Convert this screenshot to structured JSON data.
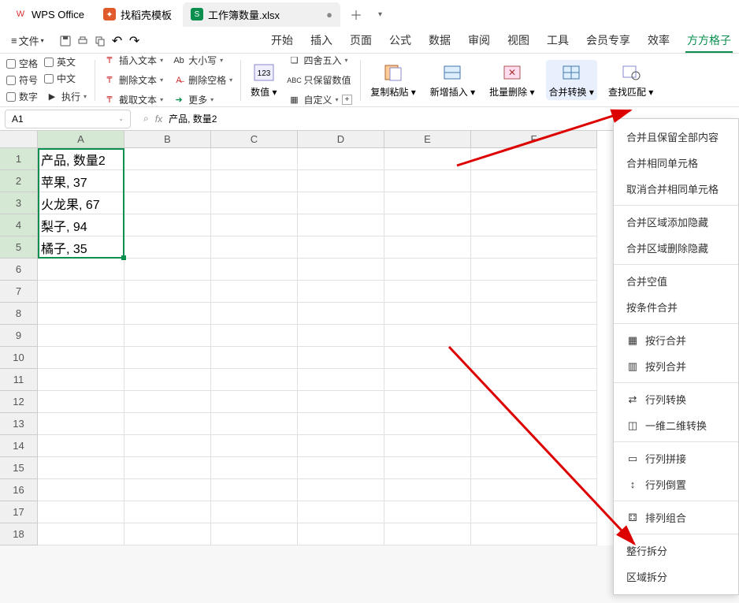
{
  "title_tabs": [
    {
      "icon": "wps",
      "label": "WPS Office"
    },
    {
      "icon": "doc",
      "label": "找稻壳模板"
    },
    {
      "icon": "xls",
      "label": "工作簿数量.xlsx",
      "active": true,
      "dirty": true
    }
  ],
  "menu": {
    "file": "文件",
    "tabs": [
      "开始",
      "插入",
      "页面",
      "公式",
      "数据",
      "审阅",
      "视图",
      "工具",
      "会员专享",
      "效率",
      "方方格子"
    ],
    "active": 10
  },
  "ribbon": {
    "checks_col1": [
      "空格",
      "符号",
      "数字"
    ],
    "checks_col2": [
      "英文",
      "中文",
      "执行"
    ],
    "text_ops": [
      "插入文本",
      "删除文本",
      "截取文本"
    ],
    "case_ops": [
      "大小写",
      "删除空格",
      "更多"
    ],
    "num_big": "数值",
    "num_ops": [
      "四舍五入",
      "只保留数值",
      "自定义"
    ],
    "big_buttons": [
      "复制粘贴",
      "新增插入",
      "批量删除",
      "合并转换",
      "查找匹配"
    ]
  },
  "formula": {
    "cell_ref": "A1",
    "value": "产品, 数量2"
  },
  "columns": [
    "A",
    "B",
    "C",
    "D",
    "E",
    "F"
  ],
  "rows": [
    {
      "n": 1,
      "a": "产品, 数量2"
    },
    {
      "n": 2,
      "a": "苹果, 37"
    },
    {
      "n": 3,
      "a": "火龙果, 67"
    },
    {
      "n": 4,
      "a": "梨子, 94"
    },
    {
      "n": 5,
      "a": "橘子, 35"
    },
    {
      "n": 6,
      "a": ""
    },
    {
      "n": 7,
      "a": ""
    },
    {
      "n": 8,
      "a": ""
    },
    {
      "n": 9,
      "a": ""
    },
    {
      "n": 10,
      "a": ""
    },
    {
      "n": 11,
      "a": ""
    },
    {
      "n": 12,
      "a": ""
    },
    {
      "n": 13,
      "a": ""
    },
    {
      "n": 14,
      "a": ""
    },
    {
      "n": 15,
      "a": ""
    },
    {
      "n": 16,
      "a": ""
    },
    {
      "n": 17,
      "a": ""
    },
    {
      "n": 18,
      "a": ""
    }
  ],
  "chart_data": {
    "type": "table",
    "description": "Selected cells A1:A5 containing CSV-like text",
    "cells": [
      "产品, 数量2",
      "苹果, 37",
      "火龙果, 67",
      "梨子, 94",
      "橘子, 35"
    ]
  },
  "dropdown": {
    "items_top": [
      "合并且保留全部内容",
      "合并相同单元格",
      "取消合并相同单元格"
    ],
    "items_mid": [
      "合并区域添加隐藏",
      "合并区域删除隐藏"
    ],
    "items_mid2": [
      "合并空值",
      "按条件合并"
    ],
    "items_icon": [
      {
        "label": "按行合并"
      },
      {
        "label": "按列合并"
      }
    ],
    "items_icon2": [
      {
        "label": "行列转换"
      },
      {
        "label": "一维二维转换"
      }
    ],
    "items_icon3": [
      {
        "label": "行列拼接"
      },
      {
        "label": "行列倒置"
      }
    ],
    "items_icon4": [
      {
        "label": "排列组合"
      }
    ],
    "items_bottom": [
      "整行拆分",
      "区域拆分"
    ]
  }
}
